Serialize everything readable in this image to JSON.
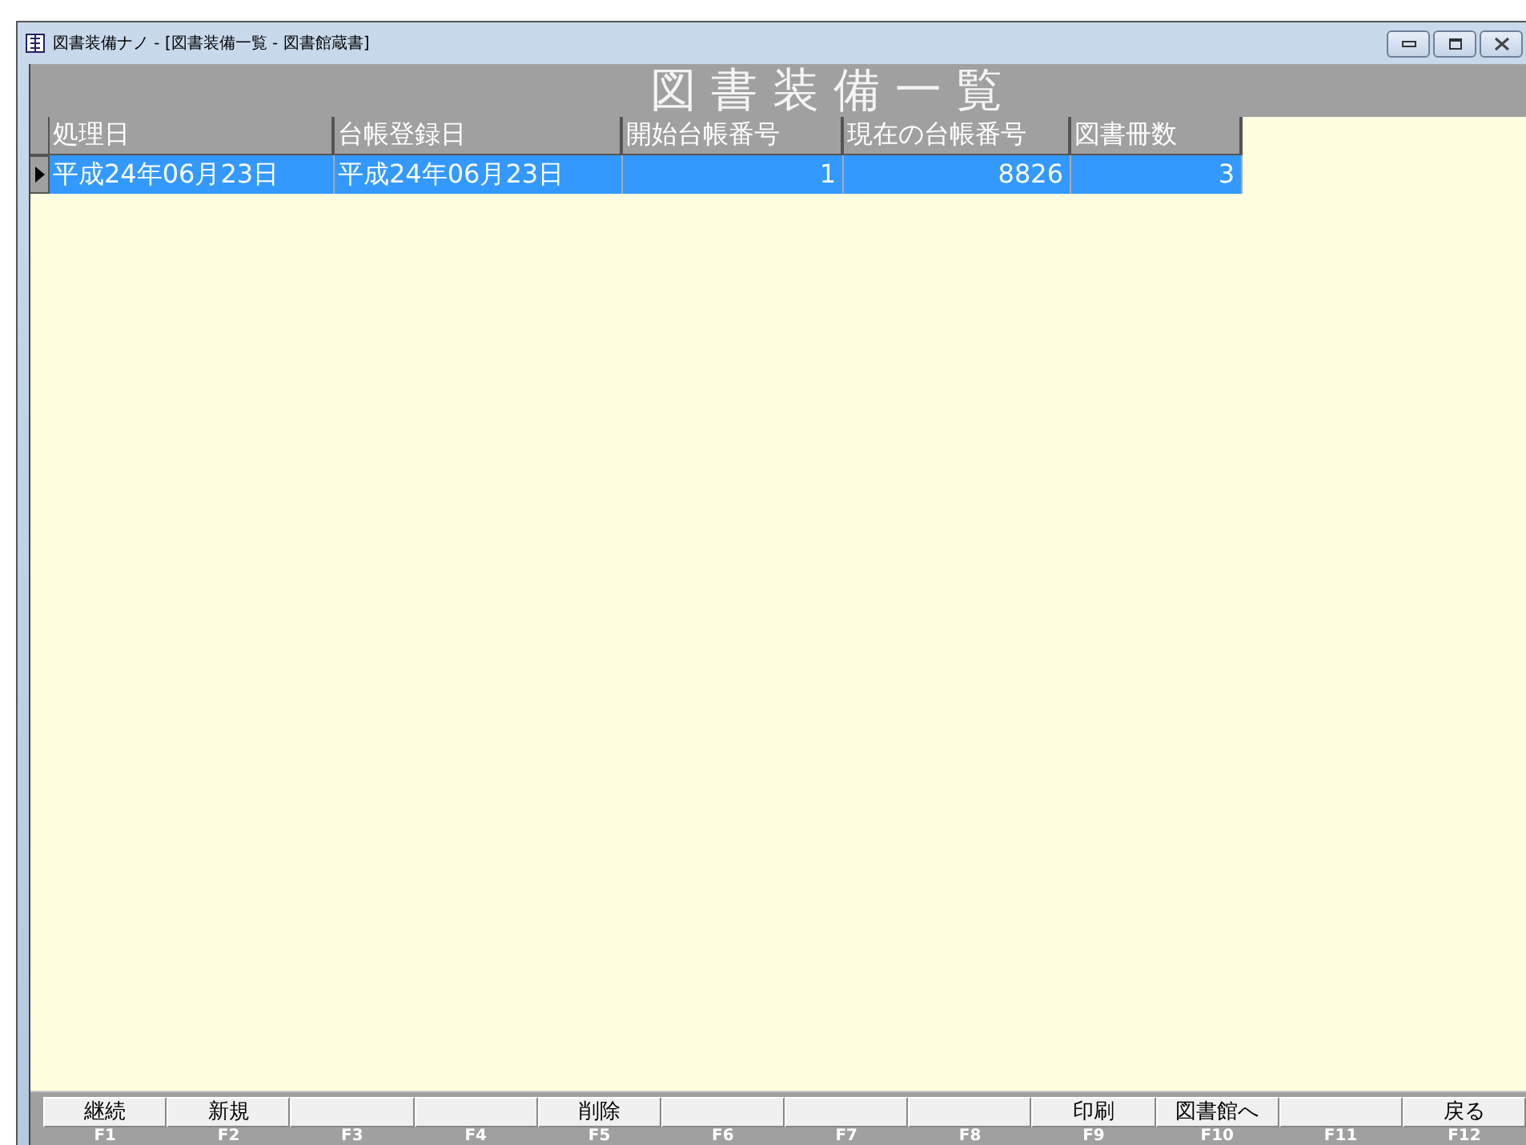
{
  "window": {
    "title": "図書装備ナノ - [図書装備一覧 - 図書館蔵書]"
  },
  "heading": "図 書 装 備 一 覧",
  "table": {
    "columns": [
      {
        "label": "処理日",
        "kind": "date"
      },
      {
        "label": "台帳登録日",
        "kind": "date"
      },
      {
        "label": "開始台帳番号",
        "kind": "number"
      },
      {
        "label": "現在の台帳番号",
        "kind": "number"
      },
      {
        "label": "図書冊数",
        "kind": "number"
      }
    ],
    "rows": [
      {
        "selected": true,
        "cells": [
          "平成24年06月23日",
          "平成24年06月23日",
          "1",
          "8826",
          "3"
        ]
      }
    ]
  },
  "function_keys": [
    {
      "label": "継続",
      "key": "F1"
    },
    {
      "label": "新規",
      "key": "F2"
    },
    {
      "key": "F3"
    },
    {
      "key": "F4"
    },
    {
      "label": "削除",
      "key": "F5"
    },
    {
      "key": "F6"
    },
    {
      "key": "F7"
    },
    {
      "key": "F8"
    },
    {
      "label": "印刷",
      "key": "F9"
    },
    {
      "label": "図書館へ",
      "key": "F10"
    },
    {
      "key": "F11"
    },
    {
      "label": "戻る",
      "key": "F12"
    }
  ]
}
